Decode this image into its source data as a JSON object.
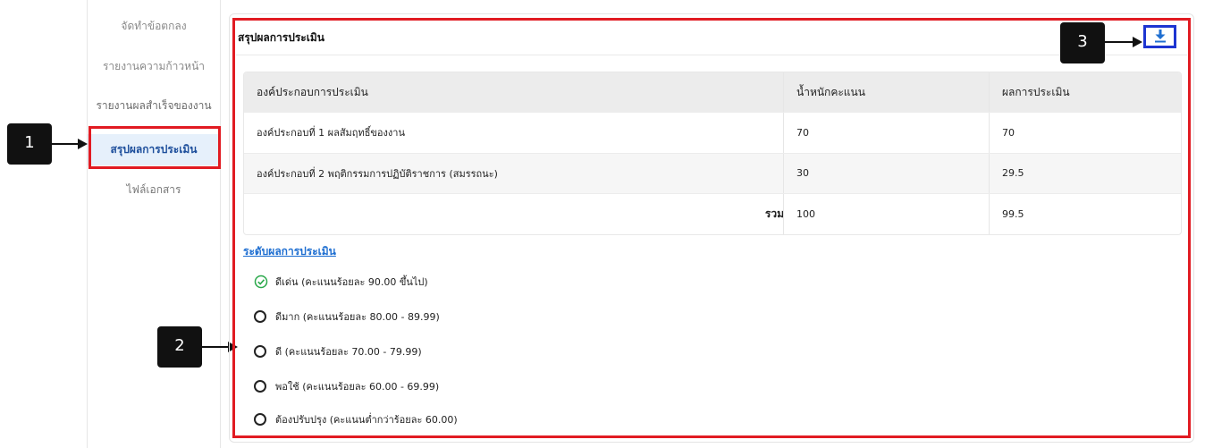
{
  "sidebar": {
    "items": [
      {
        "label": "จัดทำข้อตกลง"
      },
      {
        "label": "รายงานความก้าวหน้า"
      },
      {
        "label": "รายงานผลสำเร็จของงาน"
      },
      {
        "label": "สรุปผลการประเมิน"
      },
      {
        "label": "ไฟล์เอกสาร"
      }
    ],
    "active_index": 3
  },
  "callouts": [
    "1",
    "2",
    "3"
  ],
  "card": {
    "title": "สรุปผลการประเมิน",
    "download_icon": "download-icon"
  },
  "table": {
    "headers": [
      "องค์ประกอบการประเมิน",
      "น้ำหนักคะแนน",
      "ผลการประเมิน"
    ],
    "rows": [
      {
        "component": "องค์ประกอบที่ 1 ผลสัมฤทธิ์ของงาน",
        "weight": "70",
        "result": "70"
      },
      {
        "component": "องค์ประกอบที่ 2 พฤติกรรมการปฏิบัติราชการ (สมรรถนะ)",
        "weight": "30",
        "result": "29.5"
      }
    ],
    "total": {
      "label": "รวม",
      "weight": "100",
      "result": "99.5"
    }
  },
  "levels": {
    "title": "ระดับผลการประเมิน",
    "items": [
      {
        "label": "ดีเด่น (คะแนนร้อยละ 90.00 ขึ้นไป)",
        "selected": true
      },
      {
        "label": "ดีมาก (คะแนนร้อยละ 80.00 - 89.99)",
        "selected": false
      },
      {
        "label": "ดี (คะแนนร้อยละ 70.00 - 79.99)",
        "selected": false
      },
      {
        "label": "พอใช้ (คะแนนร้อยละ 60.00 - 69.99)",
        "selected": false
      },
      {
        "label": "ต้องปรับปรุง (คะแนนต่ำกว่าร้อยละ 60.00)",
        "selected": false
      }
    ]
  },
  "colors": {
    "highlight_red": "#e11b22",
    "highlight_blue": "#1d35d1",
    "active_menu_bg": "#e6f0fb",
    "active_menu_text": "#1e4f9c",
    "link_blue": "#1f6fd1",
    "check_green": "#2aa84a"
  }
}
